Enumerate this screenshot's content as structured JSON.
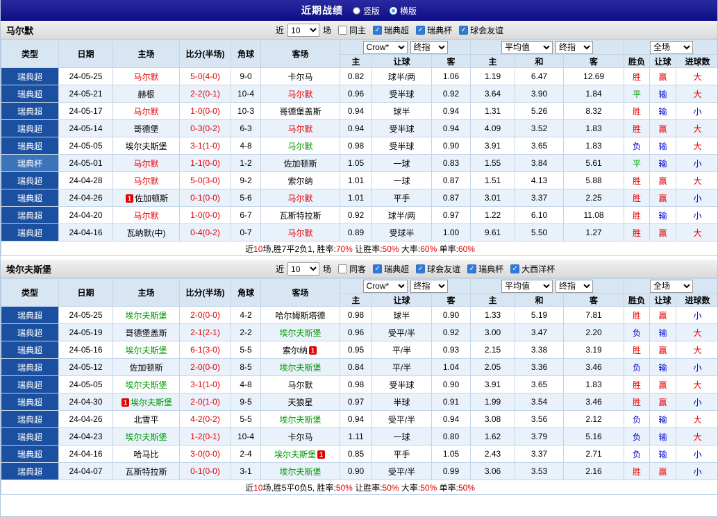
{
  "topbar": {
    "title": "近期战绩",
    "radios": [
      {
        "label": "竖版",
        "checked": false
      },
      {
        "label": "横版",
        "checked": true
      }
    ]
  },
  "header": {
    "near": "近",
    "games": "场",
    "type": "类型",
    "date": "日期",
    "home": "主场",
    "score": "比分(半场)",
    "corner": "角球",
    "away": "客场",
    "company": "Crow*",
    "final": "终指",
    "average": "平均值",
    "scope": "全场",
    "sub": [
      "主",
      "让球",
      "客",
      "主",
      "和",
      "客",
      "胜负",
      "让球",
      "进球数"
    ]
  },
  "colors": {
    "topbar_navy": "#0d0d86",
    "league_super_blue": "#1b4fa0",
    "league_cup_blue": "#3c74bc",
    "header_bg": "#d8e5f2",
    "alt_row_bg": "#e9f1fb",
    "red": "#e60000",
    "green": "#009900",
    "blue": "#0000cc"
  },
  "sections": [
    {
      "team": "马尔默",
      "filter": {
        "count": "10",
        "same": "同主",
        "same_checked": false,
        "leagues": [
          "瑞典超",
          "瑞典杯",
          "球会友谊"
        ]
      },
      "rows": [
        {
          "lg": "瑞典超",
          "d": "24-05-25",
          "h": {
            "t": "马尔默",
            "c": "r"
          },
          "s": "5-0(4-0)",
          "cn": "9-0",
          "a": {
            "t": "卡尔马",
            "c": "k"
          },
          "o": [
            "0.82",
            "球半/两",
            "1.06"
          ],
          "v": [
            "1.19",
            "6.47",
            "12.69"
          ],
          "r": {
            "t": "胜",
            "c": "r"
          },
          "l": {
            "t": "赢",
            "c": "r"
          },
          "g": {
            "t": "大",
            "c": "r"
          }
        },
        {
          "lg": "瑞典超",
          "d": "24-05-21",
          "h": {
            "t": "赫根",
            "c": "k"
          },
          "s": "2-2(0-1)",
          "cn": "10-4",
          "a": {
            "t": "马尔默",
            "c": "r"
          },
          "o": [
            "0.96",
            "受半球",
            "0.92"
          ],
          "v": [
            "3.64",
            "3.90",
            "1.84"
          ],
          "r": {
            "t": "平",
            "c": "g"
          },
          "l": {
            "t": "输",
            "c": "b"
          },
          "g": {
            "t": "大",
            "c": "r"
          }
        },
        {
          "lg": "瑞典超",
          "d": "24-05-17",
          "h": {
            "t": "马尔默",
            "c": "r"
          },
          "s": "1-0(0-0)",
          "cn": "10-3",
          "a": {
            "t": "哥德堡盖斯",
            "c": "k"
          },
          "o": [
            "0.94",
            "球半",
            "0.94"
          ],
          "v": [
            "1.31",
            "5.26",
            "8.32"
          ],
          "r": {
            "t": "胜",
            "c": "r"
          },
          "l": {
            "t": "输",
            "c": "b"
          },
          "g": {
            "t": "小",
            "c": "b"
          }
        },
        {
          "lg": "瑞典超",
          "d": "24-05-14",
          "h": {
            "t": "哥德堡",
            "c": "k"
          },
          "s": "0-3(0-2)",
          "cn": "6-3",
          "a": {
            "t": "马尔默",
            "c": "r"
          },
          "o": [
            "0.94",
            "受半球",
            "0.94"
          ],
          "v": [
            "4.09",
            "3.52",
            "1.83"
          ],
          "r": {
            "t": "胜",
            "c": "r"
          },
          "l": {
            "t": "赢",
            "c": "r"
          },
          "g": {
            "t": "大",
            "c": "r"
          }
        },
        {
          "lg": "瑞典超",
          "d": "24-05-05",
          "h": {
            "t": "埃尔夫斯堡",
            "c": "k"
          },
          "s": "3-1(1-0)",
          "cn": "4-8",
          "a": {
            "t": "马尔默",
            "c": "g"
          },
          "o": [
            "0.98",
            "受半球",
            "0.90"
          ],
          "v": [
            "3.91",
            "3.65",
            "1.83"
          ],
          "r": {
            "t": "负",
            "c": "b"
          },
          "l": {
            "t": "输",
            "c": "b"
          },
          "g": {
            "t": "大",
            "c": "r"
          }
        },
        {
          "lg": "瑞典杯",
          "cup": true,
          "d": "24-05-01",
          "h": {
            "t": "马尔默",
            "c": "r"
          },
          "s": "1-1(0-0)",
          "cn": "1-2",
          "a": {
            "t": "佐加顿斯",
            "c": "k"
          },
          "o": [
            "1.05",
            "一球",
            "0.83"
          ],
          "v": [
            "1.55",
            "3.84",
            "5.61"
          ],
          "r": {
            "t": "平",
            "c": "g"
          },
          "l": {
            "t": "输",
            "c": "b"
          },
          "g": {
            "t": "小",
            "c": "b"
          }
        },
        {
          "lg": "瑞典超",
          "d": "24-04-28",
          "h": {
            "t": "马尔默",
            "c": "r"
          },
          "s": "5-0(3-0)",
          "cn": "9-2",
          "a": {
            "t": "索尔纳",
            "c": "k"
          },
          "o": [
            "1.01",
            "一球",
            "0.87"
          ],
          "v": [
            "1.51",
            "4.13",
            "5.88"
          ],
          "r": {
            "t": "胜",
            "c": "r"
          },
          "l": {
            "t": "赢",
            "c": "r"
          },
          "g": {
            "t": "大",
            "c": "r"
          }
        },
        {
          "lg": "瑞典超",
          "d": "24-04-26",
          "h": {
            "t": "佐加顿斯",
            "c": "k",
            "bb": "1"
          },
          "s": "0-1(0-0)",
          "cn": "5-6",
          "a": {
            "t": "马尔默",
            "c": "r"
          },
          "o": [
            "1.01",
            "平手",
            "0.87"
          ],
          "v": [
            "3.01",
            "3.37",
            "2.25"
          ],
          "r": {
            "t": "胜",
            "c": "r"
          },
          "l": {
            "t": "赢",
            "c": "r"
          },
          "g": {
            "t": "小",
            "c": "b"
          }
        },
        {
          "lg": "瑞典超",
          "d": "24-04-20",
          "h": {
            "t": "马尔默",
            "c": "r"
          },
          "s": "1-0(0-0)",
          "cn": "6-7",
          "a": {
            "t": "瓦斯特拉斯",
            "c": "k"
          },
          "o": [
            "0.92",
            "球半/两",
            "0.97"
          ],
          "v": [
            "1.22",
            "6.10",
            "11.08"
          ],
          "r": {
            "t": "胜",
            "c": "r"
          },
          "l": {
            "t": "输",
            "c": "b"
          },
          "g": {
            "t": "小",
            "c": "b"
          }
        },
        {
          "lg": "瑞典超",
          "d": "24-04-16",
          "h": {
            "t": "瓦纳默(中)",
            "c": "k"
          },
          "s": "0-4(0-2)",
          "cn": "0-7",
          "a": {
            "t": "马尔默",
            "c": "r"
          },
          "o": [
            "0.89",
            "受球半",
            "1.00"
          ],
          "v": [
            "9.61",
            "5.50",
            "1.27"
          ],
          "r": {
            "t": "胜",
            "c": "r"
          },
          "l": {
            "t": "赢",
            "c": "r"
          },
          "g": {
            "t": "大",
            "c": "r"
          }
        }
      ],
      "summary": [
        {
          "t": "近"
        },
        {
          "t": "10",
          "c": "r"
        },
        {
          "t": "场,胜7平2负1, 胜率:"
        },
        {
          "t": "70%",
          "c": "r"
        },
        {
          "t": " 让胜率:"
        },
        {
          "t": "50%",
          "c": "r"
        },
        {
          "t": " 大率:"
        },
        {
          "t": "60%",
          "c": "r"
        },
        {
          "t": " 单率:"
        },
        {
          "t": "60%",
          "c": "r"
        }
      ]
    },
    {
      "team": "埃尔夫斯堡",
      "filter": {
        "count": "10",
        "same": "同客",
        "same_checked": false,
        "leagues": [
          "瑞典超",
          "球会友谊",
          "瑞典杯",
          "大西洋杯"
        ]
      },
      "rows": [
        {
          "lg": "瑞典超",
          "d": "24-05-25",
          "h": {
            "t": "埃尔夫斯堡",
            "c": "g"
          },
          "s": "2-0(0-0)",
          "cn": "4-2",
          "a": {
            "t": "哈尔姆斯塔德",
            "c": "k"
          },
          "o": [
            "0.98",
            "球半",
            "0.90"
          ],
          "v": [
            "1.33",
            "5.19",
            "7.81"
          ],
          "r": {
            "t": "胜",
            "c": "r"
          },
          "l": {
            "t": "赢",
            "c": "r"
          },
          "g": {
            "t": "小",
            "c": "b"
          }
        },
        {
          "lg": "瑞典超",
          "d": "24-05-19",
          "h": {
            "t": "哥德堡盖斯",
            "c": "k"
          },
          "s": "2-1(2-1)",
          "cn": "2-2",
          "a": {
            "t": "埃尔夫斯堡",
            "c": "g"
          },
          "o": [
            "0.96",
            "受平/半",
            "0.92"
          ],
          "v": [
            "3.00",
            "3.47",
            "2.20"
          ],
          "r": {
            "t": "负",
            "c": "b"
          },
          "l": {
            "t": "输",
            "c": "b"
          },
          "g": {
            "t": "大",
            "c": "r"
          }
        },
        {
          "lg": "瑞典超",
          "d": "24-05-16",
          "h": {
            "t": "埃尔夫斯堡",
            "c": "g"
          },
          "s": "6-1(3-0)",
          "cn": "5-5",
          "a": {
            "t": "索尔纳",
            "c": "k",
            "ba": "1"
          },
          "o": [
            "0.95",
            "平/半",
            "0.93"
          ],
          "v": [
            "2.15",
            "3.38",
            "3.19"
          ],
          "r": {
            "t": "胜",
            "c": "r"
          },
          "l": {
            "t": "赢",
            "c": "r"
          },
          "g": {
            "t": "大",
            "c": "r"
          }
        },
        {
          "lg": "瑞典超",
          "d": "24-05-12",
          "h": {
            "t": "佐加顿斯",
            "c": "k"
          },
          "s": "2-0(0-0)",
          "cn": "8-5",
          "a": {
            "t": "埃尔夫斯堡",
            "c": "g"
          },
          "o": [
            "0.84",
            "平/半",
            "1.04"
          ],
          "v": [
            "2.05",
            "3.36",
            "3.46"
          ],
          "r": {
            "t": "负",
            "c": "b"
          },
          "l": {
            "t": "输",
            "c": "b"
          },
          "g": {
            "t": "小",
            "c": "b"
          }
        },
        {
          "lg": "瑞典超",
          "d": "24-05-05",
          "h": {
            "t": "埃尔夫斯堡",
            "c": "g"
          },
          "s": "3-1(1-0)",
          "cn": "4-8",
          "a": {
            "t": "马尔默",
            "c": "k"
          },
          "o": [
            "0.98",
            "受半球",
            "0.90"
          ],
          "v": [
            "3.91",
            "3.65",
            "1.83"
          ],
          "r": {
            "t": "胜",
            "c": "r"
          },
          "l": {
            "t": "赢",
            "c": "r"
          },
          "g": {
            "t": "大",
            "c": "r"
          }
        },
        {
          "lg": "瑞典超",
          "d": "24-04-30",
          "h": {
            "t": "埃尔夫斯堡",
            "c": "g",
            "bb": "1"
          },
          "s": "2-0(1-0)",
          "cn": "9-5",
          "a": {
            "t": "天狼星",
            "c": "k"
          },
          "o": [
            "0.97",
            "半球",
            "0.91"
          ],
          "v": [
            "1.99",
            "3.54",
            "3.46"
          ],
          "r": {
            "t": "胜",
            "c": "r"
          },
          "l": {
            "t": "赢",
            "c": "r"
          },
          "g": {
            "t": "小",
            "c": "b"
          }
        },
        {
          "lg": "瑞典超",
          "d": "24-04-26",
          "h": {
            "t": "北雪平",
            "c": "k"
          },
          "s": "4-2(0-2)",
          "cn": "5-5",
          "a": {
            "t": "埃尔夫斯堡",
            "c": "g"
          },
          "o": [
            "0.94",
            "受平/半",
            "0.94"
          ],
          "v": [
            "3.08",
            "3.56",
            "2.12"
          ],
          "r": {
            "t": "负",
            "c": "b"
          },
          "l": {
            "t": "输",
            "c": "b"
          },
          "g": {
            "t": "大",
            "c": "r"
          }
        },
        {
          "lg": "瑞典超",
          "d": "24-04-23",
          "h": {
            "t": "埃尔夫斯堡",
            "c": "g"
          },
          "s": "1-2(0-1)",
          "cn": "10-4",
          "a": {
            "t": "卡尔马",
            "c": "k"
          },
          "o": [
            "1.11",
            "一球",
            "0.80"
          ],
          "v": [
            "1.62",
            "3.79",
            "5.16"
          ],
          "r": {
            "t": "负",
            "c": "b"
          },
          "l": {
            "t": "输",
            "c": "b"
          },
          "g": {
            "t": "大",
            "c": "r"
          }
        },
        {
          "lg": "瑞典超",
          "d": "24-04-16",
          "h": {
            "t": "哈马比",
            "c": "k"
          },
          "s": "3-0(0-0)",
          "cn": "2-4",
          "a": {
            "t": "埃尔夫斯堡",
            "c": "g",
            "ba": "1"
          },
          "o": [
            "0.85",
            "平手",
            "1.05"
          ],
          "v": [
            "2.43",
            "3.37",
            "2.71"
          ],
          "r": {
            "t": "负",
            "c": "b"
          },
          "l": {
            "t": "输",
            "c": "b"
          },
          "g": {
            "t": "小",
            "c": "b"
          }
        },
        {
          "lg": "瑞典超",
          "d": "24-04-07",
          "h": {
            "t": "瓦斯特拉斯",
            "c": "k"
          },
          "s": "0-1(0-0)",
          "cn": "3-1",
          "a": {
            "t": "埃尔夫斯堡",
            "c": "g"
          },
          "o": [
            "0.90",
            "受平/半",
            "0.99"
          ],
          "v": [
            "3.06",
            "3.53",
            "2.16"
          ],
          "r": {
            "t": "胜",
            "c": "r"
          },
          "l": {
            "t": "赢",
            "c": "r"
          },
          "g": {
            "t": "小",
            "c": "b"
          }
        }
      ],
      "summary": [
        {
          "t": "近"
        },
        {
          "t": "10",
          "c": "r"
        },
        {
          "t": "场,胜5平0负5, 胜率:"
        },
        {
          "t": "50%",
          "c": "r"
        },
        {
          "t": " 让胜率:"
        },
        {
          "t": "50%",
          "c": "r"
        },
        {
          "t": " 大率:"
        },
        {
          "t": "50%",
          "c": "r"
        },
        {
          "t": " 单率:"
        },
        {
          "t": "50%",
          "c": "r"
        }
      ]
    }
  ]
}
